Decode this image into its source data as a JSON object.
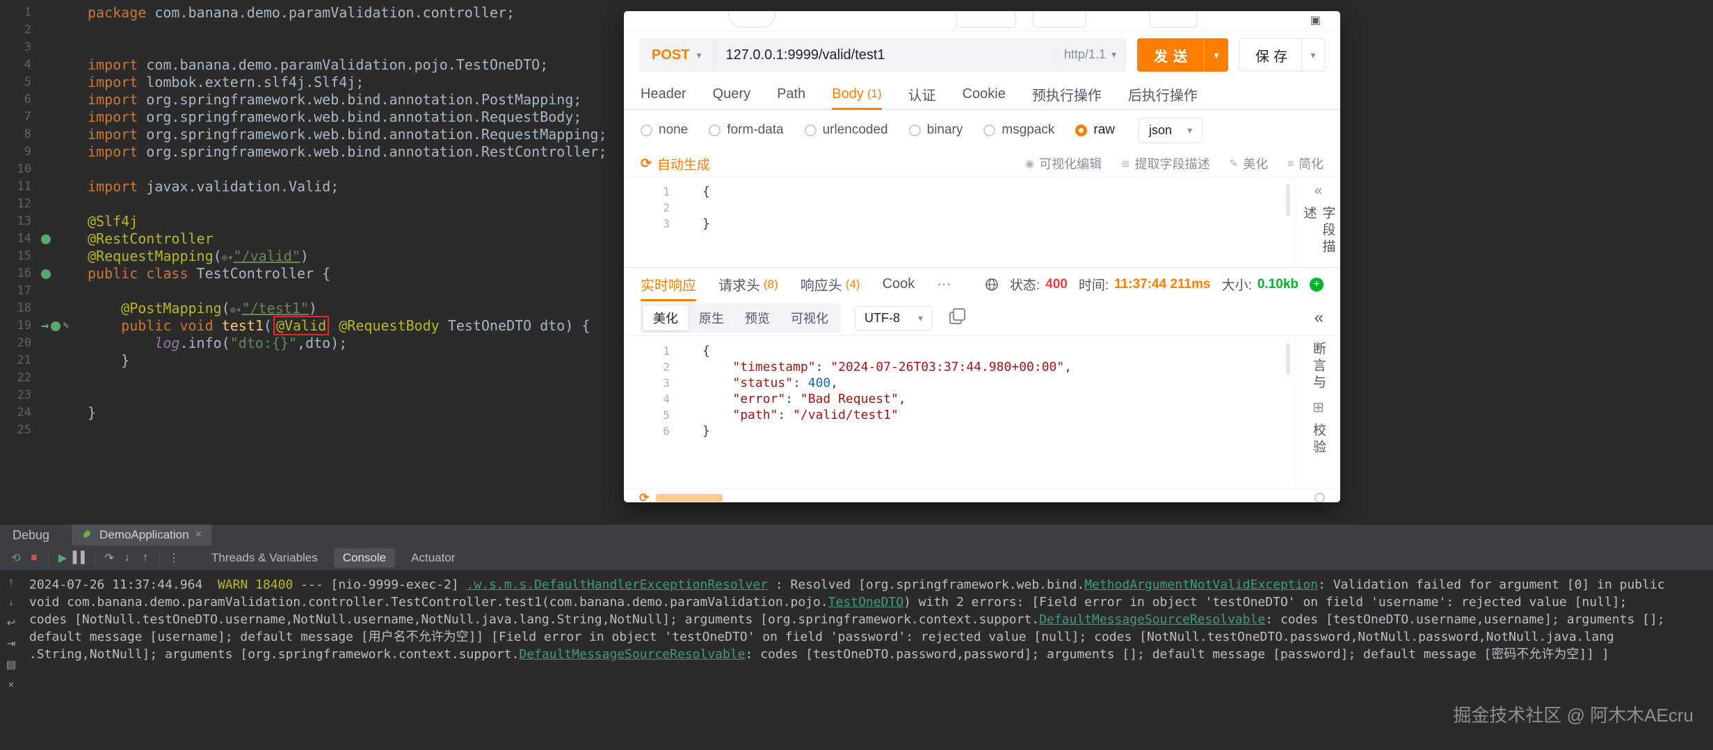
{
  "colors": {
    "accent_orange": "#ff7d00",
    "status_red": "#f53f3f",
    "status_green": "#00b42a",
    "ide_background": "#2b2b2b",
    "annotation_highlight_red": "#f5222d"
  },
  "editor": {
    "lines": [
      {
        "num": "1",
        "segs": [
          {
            "t": "package ",
            "c": "kw"
          },
          {
            "t": "com.banana.demo.paramValidation.controller;",
            "c": "pl"
          }
        ]
      },
      {
        "num": "2",
        "segs": []
      },
      {
        "num": "3",
        "segs": []
      },
      {
        "num": "4",
        "segs": [
          {
            "t": "import ",
            "c": "kw"
          },
          {
            "t": "com.banana.demo.paramValidation.pojo.TestOneDTO;",
            "c": "pl"
          }
        ]
      },
      {
        "num": "5",
        "segs": [
          {
            "t": "import ",
            "c": "kw"
          },
          {
            "t": "lombok.extern.slf4j.Slf4j;",
            "c": "pl"
          }
        ]
      },
      {
        "num": "6",
        "segs": [
          {
            "t": "import ",
            "c": "kw"
          },
          {
            "t": "org.springframework.web.bind.annotation.PostMapping;",
            "c": "pl"
          }
        ]
      },
      {
        "num": "7",
        "segs": [
          {
            "t": "import ",
            "c": "kw"
          },
          {
            "t": "org.springframework.web.bind.annotation.RequestBody;",
            "c": "pl"
          }
        ]
      },
      {
        "num": "8",
        "segs": [
          {
            "t": "import ",
            "c": "kw"
          },
          {
            "t": "org.springframework.web.bind.annotation.RequestMapping;",
            "c": "pl"
          }
        ]
      },
      {
        "num": "9",
        "segs": [
          {
            "t": "import ",
            "c": "kw"
          },
          {
            "t": "org.springframework.web.bind.annotation.RestController;",
            "c": "pl"
          }
        ]
      },
      {
        "num": "10",
        "segs": []
      },
      {
        "num": "11",
        "segs": [
          {
            "t": "import ",
            "c": "kw"
          },
          {
            "t": "javax.validation.Valid;",
            "c": "pl"
          }
        ]
      },
      {
        "num": "12",
        "segs": []
      },
      {
        "num": "13",
        "segs": [
          {
            "t": "@Slf4j",
            "c": "ann"
          }
        ]
      },
      {
        "num": "14",
        "gutter": [
          {
            "name": "spring-bean-icon",
            "c": "bean"
          }
        ],
        "segs": [
          {
            "t": "@RestController",
            "c": "ann"
          }
        ]
      },
      {
        "num": "15",
        "segs": [
          {
            "t": "@RequestMapping",
            "c": "ann"
          },
          {
            "t": "(",
            "c": "pl"
          },
          {
            "t": "⊕▾",
            "c": "inlay"
          },
          {
            "t": "\"/valid\"",
            "c": "strlink"
          },
          {
            "t": ")",
            "c": "pl"
          }
        ]
      },
      {
        "num": "16",
        "gutter": [
          {
            "name": "spring-bean-icon",
            "c": "bean"
          }
        ],
        "segs": [
          {
            "t": "public class ",
            "c": "kw"
          },
          {
            "t": "TestController {",
            "c": "pl"
          }
        ]
      },
      {
        "num": "17",
        "segs": []
      },
      {
        "num": "18",
        "segs": [
          {
            "t": "    ",
            "c": "pl"
          },
          {
            "t": "@PostMapping",
            "c": "ann"
          },
          {
            "t": "(",
            "c": "pl"
          },
          {
            "t": "⊕▾",
            "c": "inlay"
          },
          {
            "t": "\"/test1\"",
            "c": "strlink"
          },
          {
            "t": ")",
            "c": "pl"
          }
        ]
      },
      {
        "num": "19",
        "gutter": [
          {
            "name": "execution-arrow-icon",
            "c": "arrow",
            "t": "→"
          },
          {
            "name": "spring-bean-icon",
            "c": "bean"
          },
          {
            "name": "edit-icon",
            "c": "pencil",
            "t": "✎"
          }
        ],
        "segs": [
          {
            "t": "    ",
            "c": "pl"
          },
          {
            "t": "public void ",
            "c": "kw"
          },
          {
            "t": "test1",
            "c": "meth"
          },
          {
            "t": "(",
            "c": "pl"
          },
          {
            "t": "@Valid",
            "c": "annbox"
          },
          {
            "t": " ",
            "c": "pl"
          },
          {
            "t": "@RequestBody",
            "c": "ann"
          },
          {
            "t": " TestOneDTO dto) {",
            "c": "pl"
          }
        ]
      },
      {
        "num": "20",
        "segs": [
          {
            "t": "        ",
            "c": "pl"
          },
          {
            "t": "log",
            "c": "fld"
          },
          {
            "t": ".info(",
            "c": "pl"
          },
          {
            "t": "\"dto:{}\"",
            "c": "str"
          },
          {
            "t": ",dto);",
            "c": "pl"
          }
        ]
      },
      {
        "num": "21",
        "segs": [
          {
            "t": "    }",
            "c": "pl"
          }
        ]
      },
      {
        "num": "22",
        "segs": []
      },
      {
        "num": "23",
        "segs": []
      },
      {
        "num": "24",
        "segs": [
          {
            "t": "}",
            "c": "pl"
          }
        ]
      },
      {
        "num": "25",
        "segs": []
      }
    ]
  },
  "api": {
    "method": "POST",
    "url": "127.0.0.1:9999/valid/test1",
    "http_version": "http/1.1",
    "send_label": "发送",
    "save_label": "保存",
    "request_tabs": [
      {
        "key": "header",
        "label": "Header"
      },
      {
        "key": "query",
        "label": "Query"
      },
      {
        "key": "path",
        "label": "Path"
      },
      {
        "key": "body",
        "label": "Body",
        "count": "(1)",
        "active": true
      },
      {
        "key": "auth",
        "label": "认证"
      },
      {
        "key": "cookie",
        "label": "Cookie"
      },
      {
        "key": "pre-ops",
        "label": "预执行操作"
      },
      {
        "key": "post-ops",
        "label": "后执行操作"
      }
    ],
    "body_types": [
      {
        "key": "none",
        "label": "none"
      },
      {
        "key": "form-data",
        "label": "form-data"
      },
      {
        "key": "urlencoded",
        "label": "urlencoded"
      },
      {
        "key": "binary",
        "label": "binary"
      },
      {
        "key": "msgpack",
        "label": "msgpack"
      },
      {
        "key": "raw",
        "label": "raw",
        "selected": true
      }
    ],
    "raw_type": "json",
    "auto_generate": "自动生成",
    "editor_actions": [
      {
        "key": "visual-edit",
        "label": "可视化编辑",
        "icon": "◉"
      },
      {
        "key": "extract-field-desc",
        "label": "提取字段描述",
        "icon": "≣"
      },
      {
        "key": "beautify",
        "label": "美化",
        "icon": "✎"
      },
      {
        "key": "simplify",
        "label": "简化",
        "icon": "≡"
      }
    ],
    "request_body_lines": [
      {
        "num": "1",
        "segs": [
          {
            "t": "{",
            "c": "p"
          }
        ]
      },
      {
        "num": "2",
        "segs": []
      },
      {
        "num": "3",
        "segs": [
          {
            "t": "}",
            "c": "p"
          }
        ]
      }
    ],
    "field_desc_vertical": "字段描述",
    "response_tabs": [
      {
        "key": "realtime-response",
        "label": "实时响应",
        "active": true
      },
      {
        "key": "request-headers",
        "label": "请求头",
        "count": "(8)"
      },
      {
        "key": "response-headers",
        "label": "响应头",
        "count": "(4)"
      },
      {
        "key": "cookie",
        "label": "Cook"
      }
    ],
    "status_label": "状态:",
    "status_value": "400",
    "time_label": "时间:",
    "time_value": "11:37:44 211ms",
    "size_label": "大小:",
    "size_value": "0.10kb",
    "view_tabs": [
      {
        "key": "beautify",
        "label": "美化",
        "active": true
      },
      {
        "key": "raw",
        "label": "原生"
      },
      {
        "key": "preview",
        "label": "预览"
      },
      {
        "key": "visualize",
        "label": "可视化"
      }
    ],
    "encoding": "UTF-8",
    "response_lines": [
      {
        "num": "1",
        "segs": [
          {
            "t": "{",
            "c": "p"
          }
        ]
      },
      {
        "num": "2",
        "segs": [
          {
            "t": "    ",
            "c": "p"
          },
          {
            "t": "\"timestamp\"",
            "c": "k"
          },
          {
            "t": ": ",
            "c": "p"
          },
          {
            "t": "\"2024-07-26T03:37:44.980+00:00\"",
            "c": "s"
          },
          {
            "t": ",",
            "c": "p"
          }
        ]
      },
      {
        "num": "3",
        "segs": [
          {
            "t": "    ",
            "c": "p"
          },
          {
            "t": "\"status\"",
            "c": "k"
          },
          {
            "t": ": ",
            "c": "p"
          },
          {
            "t": "400",
            "c": "n"
          },
          {
            "t": ",",
            "c": "p"
          }
        ]
      },
      {
        "num": "4",
        "segs": [
          {
            "t": "    ",
            "c": "p"
          },
          {
            "t": "\"error\"",
            "c": "k"
          },
          {
            "t": ": ",
            "c": "p"
          },
          {
            "t": "\"Bad Request\"",
            "c": "s"
          },
          {
            "t": ",",
            "c": "p"
          }
        ]
      },
      {
        "num": "5",
        "segs": [
          {
            "t": "    ",
            "c": "p"
          },
          {
            "t": "\"path\"",
            "c": "k"
          },
          {
            "t": ": ",
            "c": "p"
          },
          {
            "t": "\"/valid/test1\"",
            "c": "s"
          }
        ]
      },
      {
        "num": "6",
        "segs": [
          {
            "t": "}",
            "c": "p"
          }
        ]
      }
    ],
    "assert_label_top": "断言与",
    "assert_label_bottom": "校验"
  },
  "debug": {
    "panel_label": "Debug",
    "run_tab_label": "DemoApplication",
    "toolbar_icons": [
      {
        "name": "rerun-icon",
        "glyph": "⟲",
        "cls": "g"
      },
      {
        "name": "stop-icon",
        "glyph": "■",
        "cls": "r"
      },
      {
        "name": "sep"
      },
      {
        "name": "resume-icon",
        "glyph": "▶",
        "cls": "g"
      },
      {
        "name": "pause-icon",
        "glyph": "▌▌",
        "cls": "n"
      },
      {
        "name": "sep"
      },
      {
        "name": "step-over-icon",
        "glyph": "↷",
        "cls": "n"
      },
      {
        "name": "step-into-icon",
        "glyph": "↓",
        "cls": "n"
      },
      {
        "name": "step-out-icon",
        "glyph": "↑",
        "cls": "n"
      },
      {
        "name": "sep"
      },
      {
        "name": "more-options-icon",
        "glyph": "⋮",
        "cls": "n"
      }
    ],
    "view_tabs": [
      {
        "key": "threads-variables",
        "label": "Threads & Variables"
      },
      {
        "key": "console",
        "label": "Console",
        "active": true
      },
      {
        "key": "actuator",
        "label": "Actuator"
      }
    ],
    "console_strip_icons": [
      {
        "name": "prev-frame-icon",
        "glyph": "↑"
      },
      {
        "name": "next-frame-icon",
        "glyph": "↓"
      },
      {
        "name": "soft-wrap-icon",
        "glyph": "↩"
      },
      {
        "name": "scroll-to-end-icon",
        "glyph": "⇥"
      },
      {
        "name": "print-icon",
        "glyph": "▤"
      },
      {
        "name": "clear-console-icon",
        "glyph": "×"
      }
    ],
    "console_lines": [
      [
        {
          "t": "2024-07-26 11:37:44.964  ",
          "c": "d"
        },
        {
          "t": "WARN 18400",
          "c": "y"
        },
        {
          "t": " --- [nio-9999-exec-2] ",
          "c": "d"
        },
        {
          "t": ".w.s.m.s.DefaultHandlerExceptionResolver",
          "c": "t"
        },
        {
          "t": " : Resolved [org.springframework.web.bind.",
          "c": "d"
        },
        {
          "t": "MethodArgumentNotValidException",
          "c": "t"
        },
        {
          "t": ": Validation failed for argument [0] in public",
          "c": "d"
        }
      ],
      [
        {
          "t": "void com.banana.demo.paramValidation.controller.TestController.test1(com.banana.demo.paramValidation.pojo.",
          "c": "d"
        },
        {
          "t": "TestOneDTO",
          "c": "t"
        },
        {
          "t": ") with 2 errors: [Field error in object 'testOneDTO' on field 'username': rejected value [null];",
          "c": "d"
        }
      ],
      [
        {
          "t": "codes [NotNull.testOneDTO.username,NotNull.username,NotNull.java.lang.String,NotNull]; arguments [org.springframework.context.support.",
          "c": "d"
        },
        {
          "t": "DefaultMessageSourceResolvable",
          "c": "t"
        },
        {
          "t": ": codes [testOneDTO.username,username]; arguments [];",
          "c": "d"
        }
      ],
      [
        {
          "t": "default message [username]; default message [用户名不允许为空]] [Field error in object 'testOneDTO' on field 'password': rejected value [null]; codes [NotNull.testOneDTO.password,NotNull.password,NotNull.java.lang",
          "c": "d"
        }
      ],
      [
        {
          "t": ".String,NotNull]; arguments [org.springframework.context.support.",
          "c": "d"
        },
        {
          "t": "DefaultMessageSourceResolvable",
          "c": "t"
        },
        {
          "t": ": codes [testOneDTO.password,password]; arguments []; default message [password]; default message [密码不允许为空]] ]",
          "c": "d"
        }
      ]
    ]
  },
  "watermark": "掘金技术社区 @ 阿木木AEcru"
}
